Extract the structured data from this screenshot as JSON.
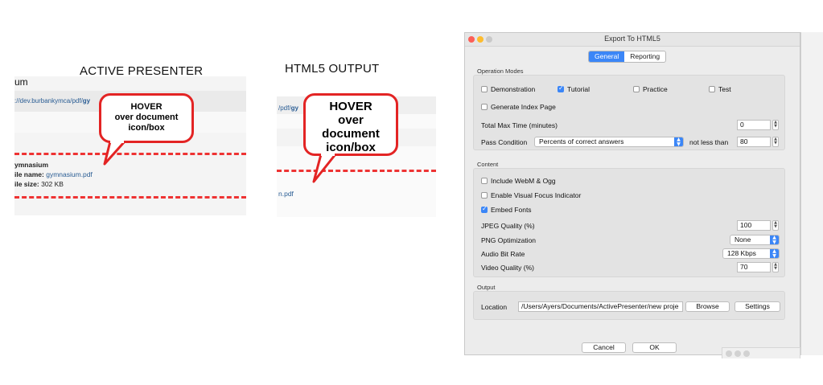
{
  "left_panel": {
    "title": "ACTIVE PRESENTER",
    "header_fragment": "um",
    "url_prefix": "://dev.burbankymca/pdf/",
    "url_bold": "gy",
    "item_name": "ymnasium",
    "file_name_label": "ile name:",
    "file_name_value": "gymnasium.pdf",
    "file_size_label": "ile size:",
    "file_size_value": "302 KB",
    "bubble_line1": "HOVER",
    "bubble_line2": "over document",
    "bubble_line3": "icon/box"
  },
  "right_panel": {
    "title": "HTML5 OUTPUT",
    "url_prefix": "/pdf/",
    "url_bold": "gy",
    "link_fragment": "n.pdf",
    "bubble_line1": "HOVER",
    "bubble_line2": "over",
    "bubble_line3": "document",
    "bubble_line4": "icon/box"
  },
  "dialog": {
    "title": "Export To HTML5",
    "tabs": [
      {
        "label": "General",
        "active": true
      },
      {
        "label": "Reporting",
        "active": false
      }
    ],
    "operation_modes": {
      "label": "Operation Modes",
      "modes": [
        {
          "label": "Demonstration",
          "checked": false
        },
        {
          "label": "Tutorial",
          "checked": true
        },
        {
          "label": "Practice",
          "checked": false
        },
        {
          "label": "Test",
          "checked": false
        }
      ],
      "generate_index": {
        "label": "Generate Index Page",
        "checked": false
      },
      "total_max_time": {
        "label": "Total Max Time (minutes)",
        "value": "0"
      },
      "pass_condition": {
        "label": "Pass Condition",
        "value": "Percents of correct answers",
        "not_less_than_label": "not less than",
        "threshold": "80"
      }
    },
    "content": {
      "label": "Content",
      "include_webm": {
        "label": "Include WebM & Ogg",
        "checked": false
      },
      "visual_focus": {
        "label": "Enable Visual Focus Indicator",
        "checked": false
      },
      "embed_fonts": {
        "label": "Embed Fonts",
        "checked": true
      },
      "jpeg_quality": {
        "label": "JPEG Quality (%)",
        "value": "100"
      },
      "png_optimization": {
        "label": "PNG Optimization",
        "value": "None"
      },
      "audio_bit_rate": {
        "label": "Audio Bit Rate",
        "value": "128 Kbps"
      },
      "video_quality": {
        "label": "Video Quality (%)",
        "value": "70"
      }
    },
    "output": {
      "label": "Output",
      "location_label": "Location",
      "location_value": "/Users/Ayers/Documents/ActivePresenter/new proje",
      "browse_label": "Browse",
      "settings_label": "Settings"
    },
    "cancel_label": "Cancel",
    "ok_label": "OK"
  },
  "colors": {
    "accent": "#3b86f7",
    "bubble_border": "#e32424",
    "dash": "#ee3333",
    "link": "#2a5d94"
  }
}
